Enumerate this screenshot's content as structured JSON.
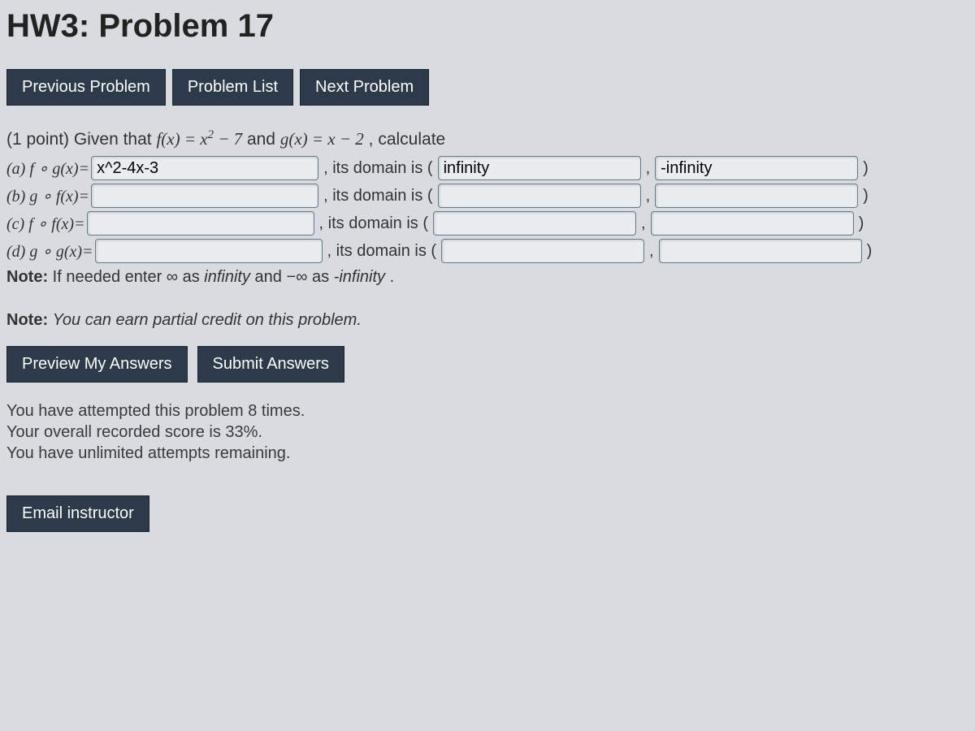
{
  "title": "HW3: Problem 17",
  "nav": {
    "prev": "Previous Problem",
    "list": "Problem List",
    "next": "Next Problem"
  },
  "prompt": {
    "points": "(1 point)",
    "text1": "Given that ",
    "f_def": "f(x) = x² − 7",
    "text2": " and ",
    "g_def": "g(x) = x − 2",
    "text3": ", calculate"
  },
  "parts": {
    "a": {
      "label": "(a) f ∘ g(x)=",
      "value": "x^2-4x-3",
      "domain_text": ", its domain is (",
      "domain_lo": "infinity",
      "comma": ",",
      "domain_hi": "-infinity",
      "close": ")"
    },
    "b": {
      "label": "(b) g ∘ f(x)=",
      "value": "",
      "domain_text": ", its domain is (",
      "domain_lo": "",
      "comma": ",",
      "domain_hi": "",
      "close": ")"
    },
    "c": {
      "label": "(c) f ∘ f(x)=",
      "value": "",
      "domain_text": ", its domain is (",
      "domain_lo": "",
      "comma": ",",
      "domain_hi": "",
      "close": ")"
    },
    "d": {
      "label": "(d) g ∘ g(x)=",
      "value": "",
      "domain_text": ", its domain is (",
      "domain_lo": "",
      "comma": ",",
      "domain_hi": "",
      "close": ")"
    }
  },
  "note_infinity": {
    "prefix": "Note: ",
    "text1": "If needed enter ∞ as ",
    "inf": "infinity",
    "text2": " and −∞ as ",
    "ninf": "-infinity",
    "text3": " ."
  },
  "credit_note": {
    "prefix": "Note: ",
    "text": "You can earn partial credit on this problem."
  },
  "actions": {
    "preview": "Preview My Answers",
    "submit": "Submit Answers"
  },
  "status": {
    "attempts": "You have attempted this problem 8 times.",
    "score": "Your overall recorded score is 33%.",
    "remaining": "You have unlimited attempts remaining."
  },
  "email": "Email instructor"
}
